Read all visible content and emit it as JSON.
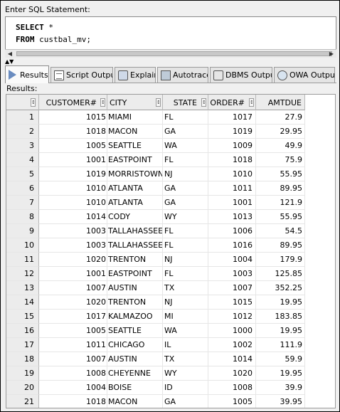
{
  "editor": {
    "label": "Enter SQL Statement:",
    "line1_kw": "SELECT",
    "line1_rest": " *",
    "line2_kw": "FROM",
    "line2_rest": " custbal_mv;"
  },
  "tabs": [
    {
      "label": "Results",
      "icon": "play-icon"
    },
    {
      "label": "Script Output",
      "icon": "script-icon"
    },
    {
      "label": "Explain",
      "icon": "explain-icon"
    },
    {
      "label": "Autotrace",
      "icon": "autotrace-icon"
    },
    {
      "label": "DBMS Output",
      "icon": "dbms-output-icon"
    },
    {
      "label": "OWA Output",
      "icon": "owa-output-icon"
    }
  ],
  "results_label": "Results:",
  "columns": [
    "",
    "CUSTOMER#",
    "CITY",
    "STATE",
    "ORDER#",
    "AMTDUE"
  ],
  "rows": [
    [
      "1",
      "1015",
      "MIAMI",
      "FL",
      "1017",
      "27.9"
    ],
    [
      "2",
      "1018",
      "MACON",
      "GA",
      "1019",
      "29.95"
    ],
    [
      "3",
      "1005",
      "SEATTLE",
      "WA",
      "1009",
      "49.9"
    ],
    [
      "4",
      "1001",
      "EASTPOINT",
      "FL",
      "1018",
      "75.9"
    ],
    [
      "5",
      "1019",
      "MORRISTOWN",
      "NJ",
      "1010",
      "55.95"
    ],
    [
      "6",
      "1010",
      "ATLANTA",
      "GA",
      "1011",
      "89.95"
    ],
    [
      "7",
      "1010",
      "ATLANTA",
      "GA",
      "1001",
      "121.9"
    ],
    [
      "8",
      "1014",
      "CODY",
      "WY",
      "1013",
      "55.95"
    ],
    [
      "9",
      "1003",
      "TALLAHASSEE",
      "FL",
      "1006",
      "54.5"
    ],
    [
      "10",
      "1003",
      "TALLAHASSEE",
      "FL",
      "1016",
      "89.95"
    ],
    [
      "11",
      "1020",
      "TRENTON",
      "NJ",
      "1004",
      "179.9"
    ],
    [
      "12",
      "1001",
      "EASTPOINT",
      "FL",
      "1003",
      "125.85"
    ],
    [
      "13",
      "1007",
      "AUSTIN",
      "TX",
      "1007",
      "352.25"
    ],
    [
      "14",
      "1020",
      "TRENTON",
      "NJ",
      "1015",
      "19.95"
    ],
    [
      "15",
      "1017",
      "KALMAZOO",
      "MI",
      "1012",
      "183.85"
    ],
    [
      "16",
      "1005",
      "SEATTLE",
      "WA",
      "1000",
      "19.95"
    ],
    [
      "17",
      "1011",
      "CHICAGO",
      "IL",
      "1002",
      "111.9"
    ],
    [
      "18",
      "1007",
      "AUSTIN",
      "TX",
      "1014",
      "59.9"
    ],
    [
      "19",
      "1008",
      "CHEYENNE",
      "WY",
      "1020",
      "19.95"
    ],
    [
      "20",
      "1004",
      "BOISE",
      "ID",
      "1008",
      "39.9"
    ],
    [
      "21",
      "1018",
      "MACON",
      "GA",
      "1005",
      "39.95"
    ]
  ]
}
